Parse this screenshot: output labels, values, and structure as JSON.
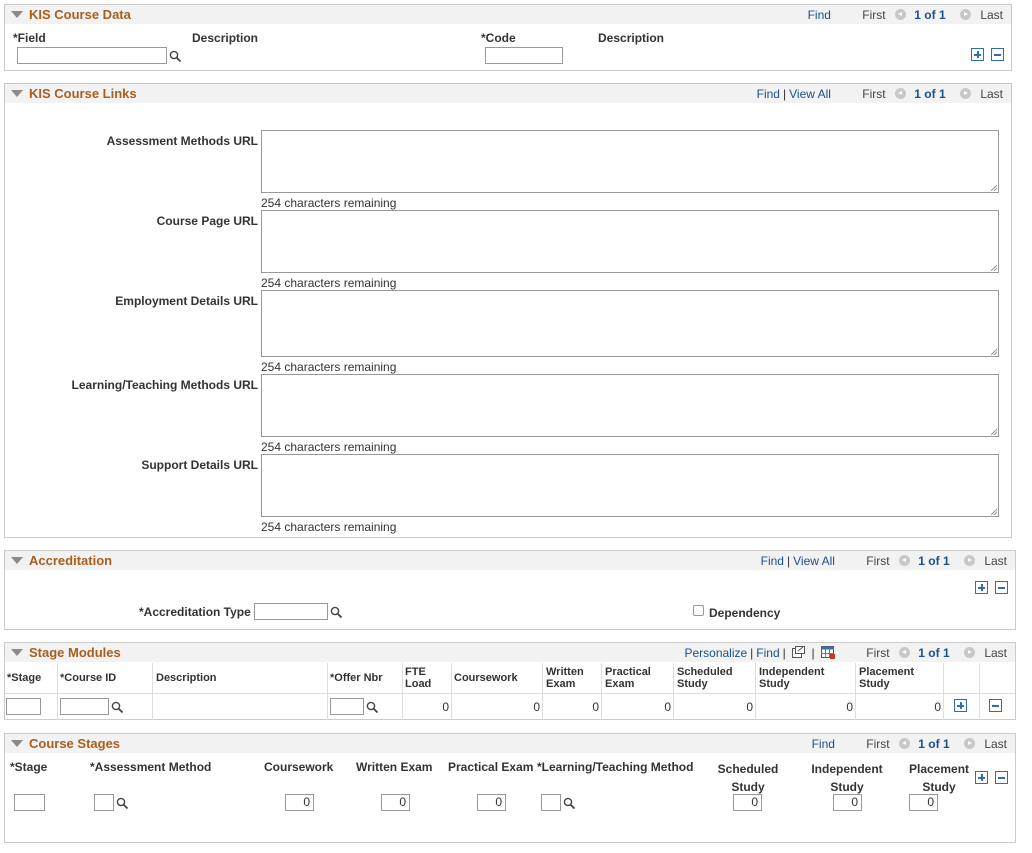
{
  "nav": {
    "find": "Find",
    "view_all": "View All",
    "first": "First",
    "last": "Last",
    "count": "1 of 1",
    "personalize": "Personalize"
  },
  "kis_course_data": {
    "title": "KIS Course Data",
    "field_label": "*Field",
    "description_label": "Description",
    "code_label": "*Code",
    "code_description_label": "Description"
  },
  "kis_course_links": {
    "title": "KIS Course Links",
    "fields": [
      {
        "label": "Assessment Methods URL",
        "remaining": "254 characters remaining"
      },
      {
        "label": "Course Page URL",
        "remaining": "254 characters remaining"
      },
      {
        "label": "Employment Details URL",
        "remaining": "254 characters remaining"
      },
      {
        "label": "Learning/Teaching Methods URL",
        "remaining": "254 characters remaining"
      },
      {
        "label": "Support Details URL",
        "remaining": "254 characters remaining"
      }
    ]
  },
  "accreditation": {
    "title": "Accreditation",
    "type_label": "*Accreditation Type",
    "dependency_label": "Dependency"
  },
  "stage_modules": {
    "title": "Stage Modules",
    "columns": [
      "*Stage",
      "*Course ID",
      "Description",
      "*Offer Nbr",
      "FTE Load",
      "Coursework",
      "Written Exam",
      "Practical Exam",
      "Scheduled Study",
      "Independent Study",
      "Placement Study"
    ],
    "row": {
      "fte": "0",
      "coursework": "0",
      "written": "0",
      "practical": "0",
      "scheduled": "0",
      "independent": "0",
      "placement": "0"
    }
  },
  "course_stages": {
    "title": "Course Stages",
    "labels": {
      "stage": "*Stage",
      "assessment": "*Assessment Method",
      "coursework": "Coursework",
      "written": "Written Exam",
      "practical": "Practical Exam",
      "learning": "*Learning/Teaching Method",
      "scheduled": "Scheduled Study",
      "independent": "Independent Study",
      "placement": "Placement Study"
    },
    "values": {
      "coursework": "0",
      "written": "0",
      "practical": "0",
      "scheduled": "0",
      "independent": "0",
      "placement": "0"
    }
  }
}
